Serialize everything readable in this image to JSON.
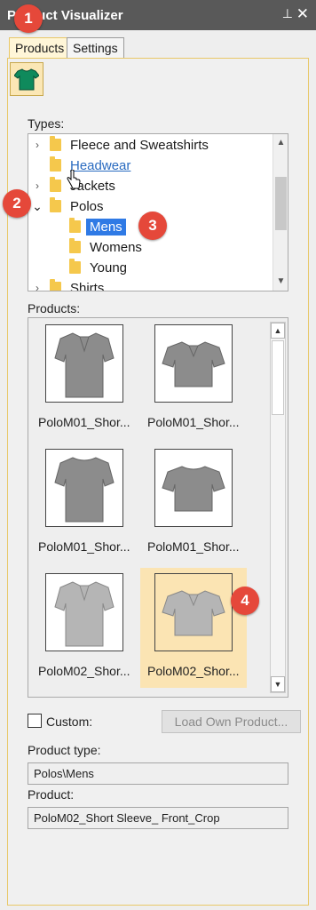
{
  "window": {
    "title": "Product Visualizer",
    "pin_glyph": "⊥",
    "close_glyph": "✕"
  },
  "tabs": [
    {
      "label": "Products",
      "active": true
    },
    {
      "label": "Settings",
      "active": false
    }
  ],
  "product_icon": "tshirt-icon",
  "types": {
    "label": "Types:",
    "items": [
      {
        "label": "Fleece and Sweatshirts",
        "expander": "›",
        "level": 0
      },
      {
        "label": "Headwear",
        "expander": "",
        "level": 0,
        "hover": true
      },
      {
        "label": "Jackets",
        "expander": "›",
        "level": 0
      },
      {
        "label": "Polos",
        "expander": "⌄",
        "level": 0
      },
      {
        "label": "Mens",
        "expander": "",
        "level": 1,
        "selected": true
      },
      {
        "label": "Womens",
        "expander": "",
        "level": 1
      },
      {
        "label": "Young",
        "expander": "",
        "level": 1
      },
      {
        "label": "Shirts",
        "expander": "›",
        "level": 0
      }
    ]
  },
  "products": {
    "label": "Products:",
    "items": [
      {
        "caption": "PoloM01_Shor...",
        "selected": false
      },
      {
        "caption": "PoloM01_Shor...",
        "selected": false
      },
      {
        "caption": "PoloM01_Shor...",
        "selected": false
      },
      {
        "caption": "PoloM01_Shor...",
        "selected": false
      },
      {
        "caption": "PoloM02_Shor...",
        "selected": false
      },
      {
        "caption": "PoloM02_Shor...",
        "selected": true
      }
    ]
  },
  "custom": {
    "label": "Custom:",
    "checked": false
  },
  "load_button": {
    "label": "Load Own Product..."
  },
  "product_type": {
    "label": "Product type:",
    "value": "Polos\\Mens"
  },
  "product": {
    "label": "Product:",
    "value": "PoloM02_Short Sleeve_ Front_Crop"
  },
  "callouts": [
    "1",
    "2",
    "3",
    "4"
  ],
  "colors": {
    "accent": "#2f7ae5",
    "callout": "#e5483a",
    "selected_tile": "#fbe4b3",
    "tab_border": "#e8c869"
  }
}
